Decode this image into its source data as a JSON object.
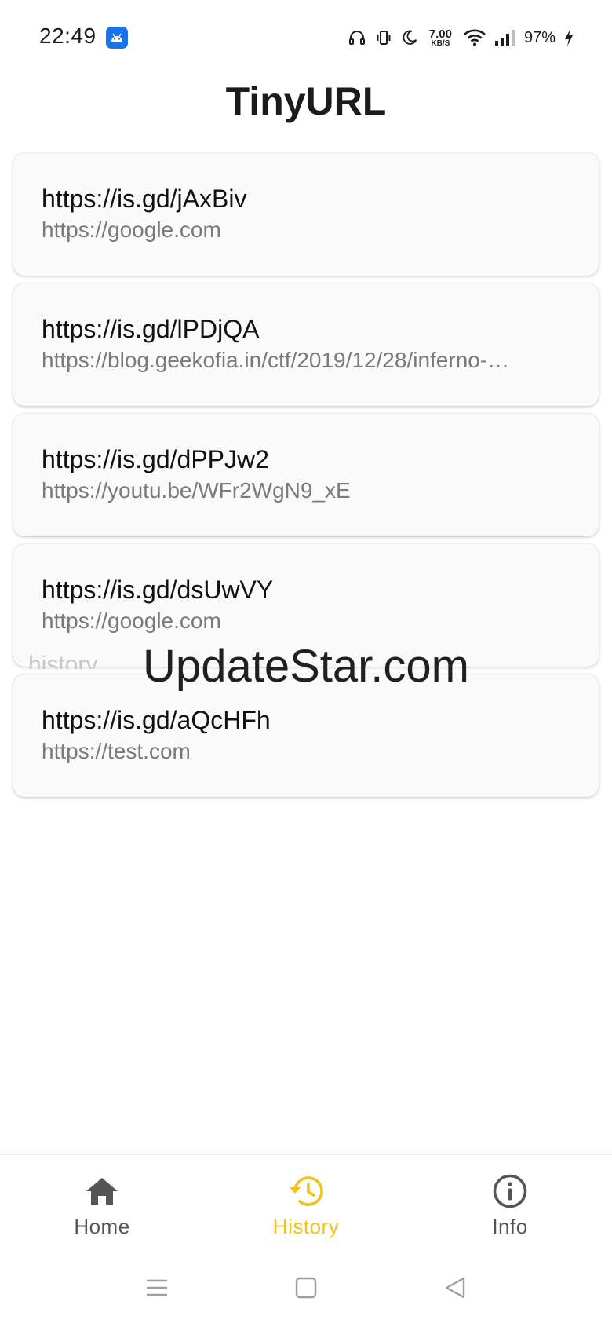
{
  "status_bar": {
    "time": "22:49",
    "net_speed_value": "7.00",
    "net_speed_unit": "KB/S",
    "battery": "97%"
  },
  "app": {
    "title": "TinyURL"
  },
  "history": {
    "items": [
      {
        "short_url": "https://is.gd/jAxBiv",
        "long_url": "https://google.com"
      },
      {
        "short_url": "https://is.gd/lPDjQA",
        "long_url": "https://blog.geekofia.in/ctf/2019/12/28/inferno-…"
      },
      {
        "short_url": "https://is.gd/dPPJw2",
        "long_url": "https://youtu.be/WFr2WgN9_xE"
      },
      {
        "short_url": "https://is.gd/dsUwVY",
        "long_url": "https://google.com"
      },
      {
        "short_url": "https://is.gd/aQcHFh",
        "long_url": "https://test.com"
      }
    ]
  },
  "watermark": {
    "ghost_text": "history",
    "text": "UpdateStar.com"
  },
  "bottom_nav": {
    "items": [
      {
        "label": "Home",
        "icon": "home-icon",
        "active": false
      },
      {
        "label": "History",
        "icon": "history-icon",
        "active": true
      },
      {
        "label": "Info",
        "icon": "info-icon",
        "active": false
      }
    ]
  },
  "colors": {
    "accent": "#f2c21b",
    "inactive": "#555555",
    "card_background": "#fafafa",
    "status_app_icon": "#1a73e8"
  },
  "system_nav": {
    "icons": [
      "menu-icon",
      "home-square-icon",
      "back-triangle-icon"
    ]
  }
}
